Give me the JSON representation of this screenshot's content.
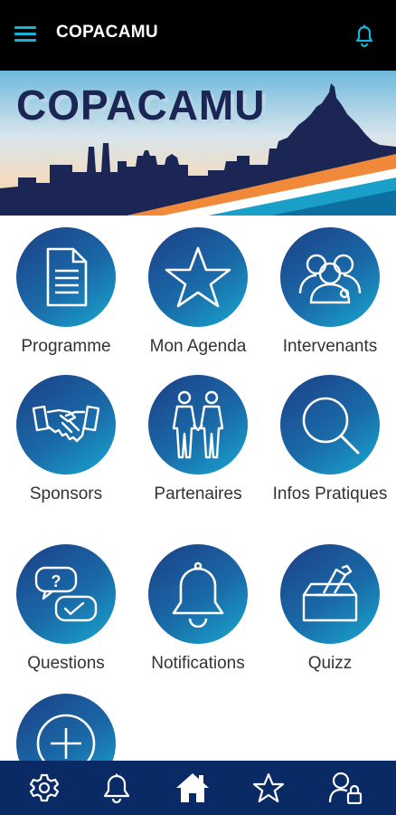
{
  "header": {
    "title": "COPACAMU",
    "menu_icon": "hamburger-icon",
    "notification_icon": "bell-icon"
  },
  "banner": {
    "title": "COPACAMU"
  },
  "menu": [
    {
      "label": "Programme",
      "icon": "document-icon"
    },
    {
      "label": "Mon Agenda",
      "icon": "star-icon"
    },
    {
      "label": "Intervenants",
      "icon": "people-group-icon"
    },
    {
      "label": "Sponsors",
      "icon": "handshake-icon"
    },
    {
      "label": "Partenaires",
      "icon": "partners-icon"
    },
    {
      "label": "Infos Pratiques",
      "icon": "magnifier-icon"
    },
    {
      "label": "Questions",
      "icon": "chat-question-icon"
    },
    {
      "label": "Notifications",
      "icon": "bell-icon"
    },
    {
      "label": "Quizz",
      "icon": "ballot-box-icon"
    },
    {
      "label": "",
      "icon": "plus-icon"
    }
  ],
  "bottom_nav": [
    "gear-icon",
    "bell-icon",
    "home-icon",
    "star-icon",
    "user-lock-icon"
  ],
  "colors": {
    "topbar": "#000000",
    "accent": "#18b4d8",
    "navy": "#0a2a66",
    "circle_start": "#1c3f86",
    "circle_end": "#18a8cf"
  }
}
